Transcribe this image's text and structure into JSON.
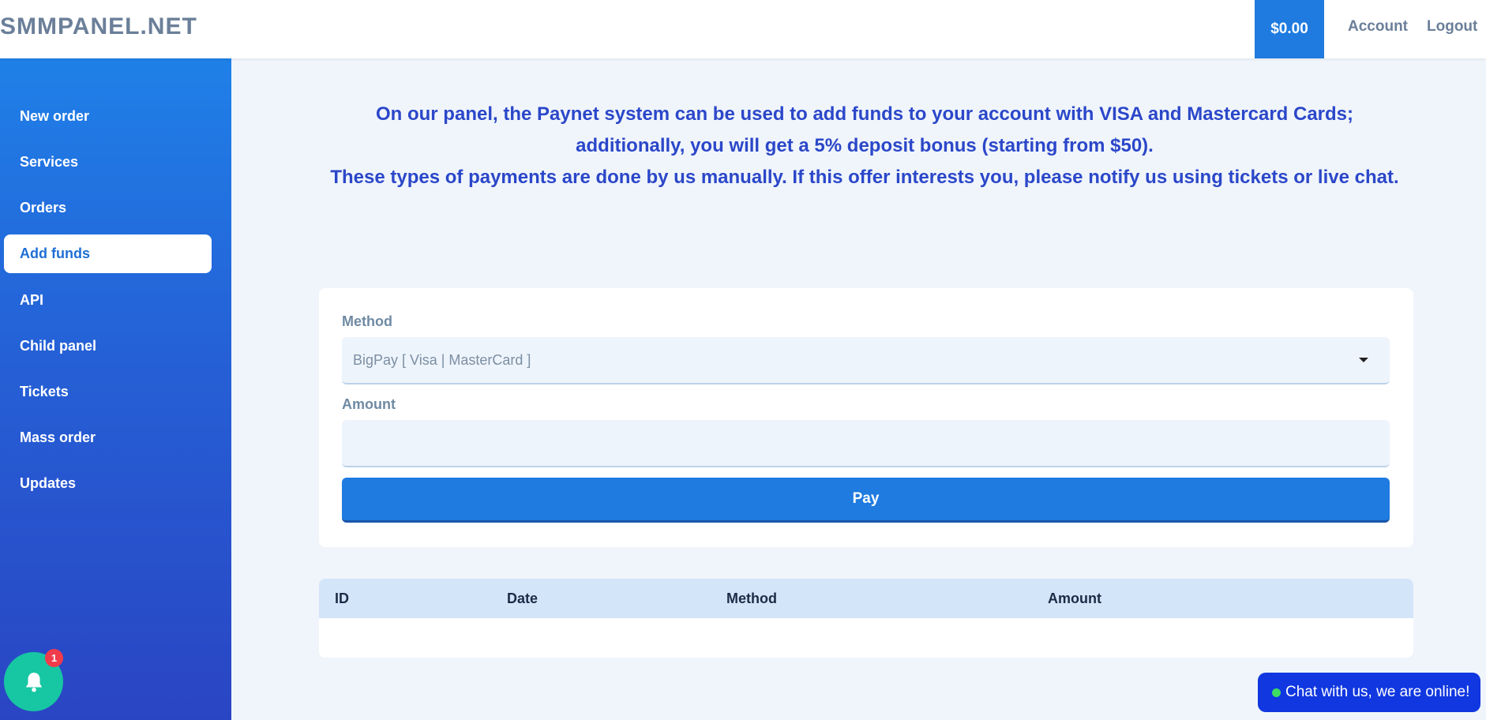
{
  "header": {
    "brand": "SMMPANEL.NET",
    "balance": "$0.00",
    "account_label": "Account",
    "logout_label": "Logout"
  },
  "sidebar": {
    "items": [
      {
        "label": "New order"
      },
      {
        "label": "Services"
      },
      {
        "label": "Orders"
      },
      {
        "label": "Add funds",
        "active": true
      },
      {
        "label": "API"
      },
      {
        "label": "Child panel"
      },
      {
        "label": "Tickets"
      },
      {
        "label": "Mass order"
      },
      {
        "label": "Updates"
      }
    ],
    "notification_count": "1"
  },
  "notice": {
    "line1": "On our panel, the Paynet system can be used to add funds to your account with VISA and Mastercard Cards;",
    "line2": "additionally, you will get a 5% deposit bonus (starting from $50).",
    "line3": "These types of payments are done by us manually. If this offer interests you, please notify us using tickets or live chat."
  },
  "form": {
    "method_label": "Method",
    "method_value": "BigPay [ Visa | MasterCard ]",
    "amount_label": "Amount",
    "amount_value": "",
    "pay_label": "Pay"
  },
  "table": {
    "columns": [
      "ID",
      "Date",
      "Method",
      "Amount"
    ],
    "rows": []
  },
  "chat": {
    "label": "Chat with us, we are online!"
  },
  "colors": {
    "accent": "#1f7be0",
    "notice_text": "#2b47c9",
    "bell": "#17c6a3",
    "badge": "#ef3b4a",
    "chat": "#1037e0"
  }
}
